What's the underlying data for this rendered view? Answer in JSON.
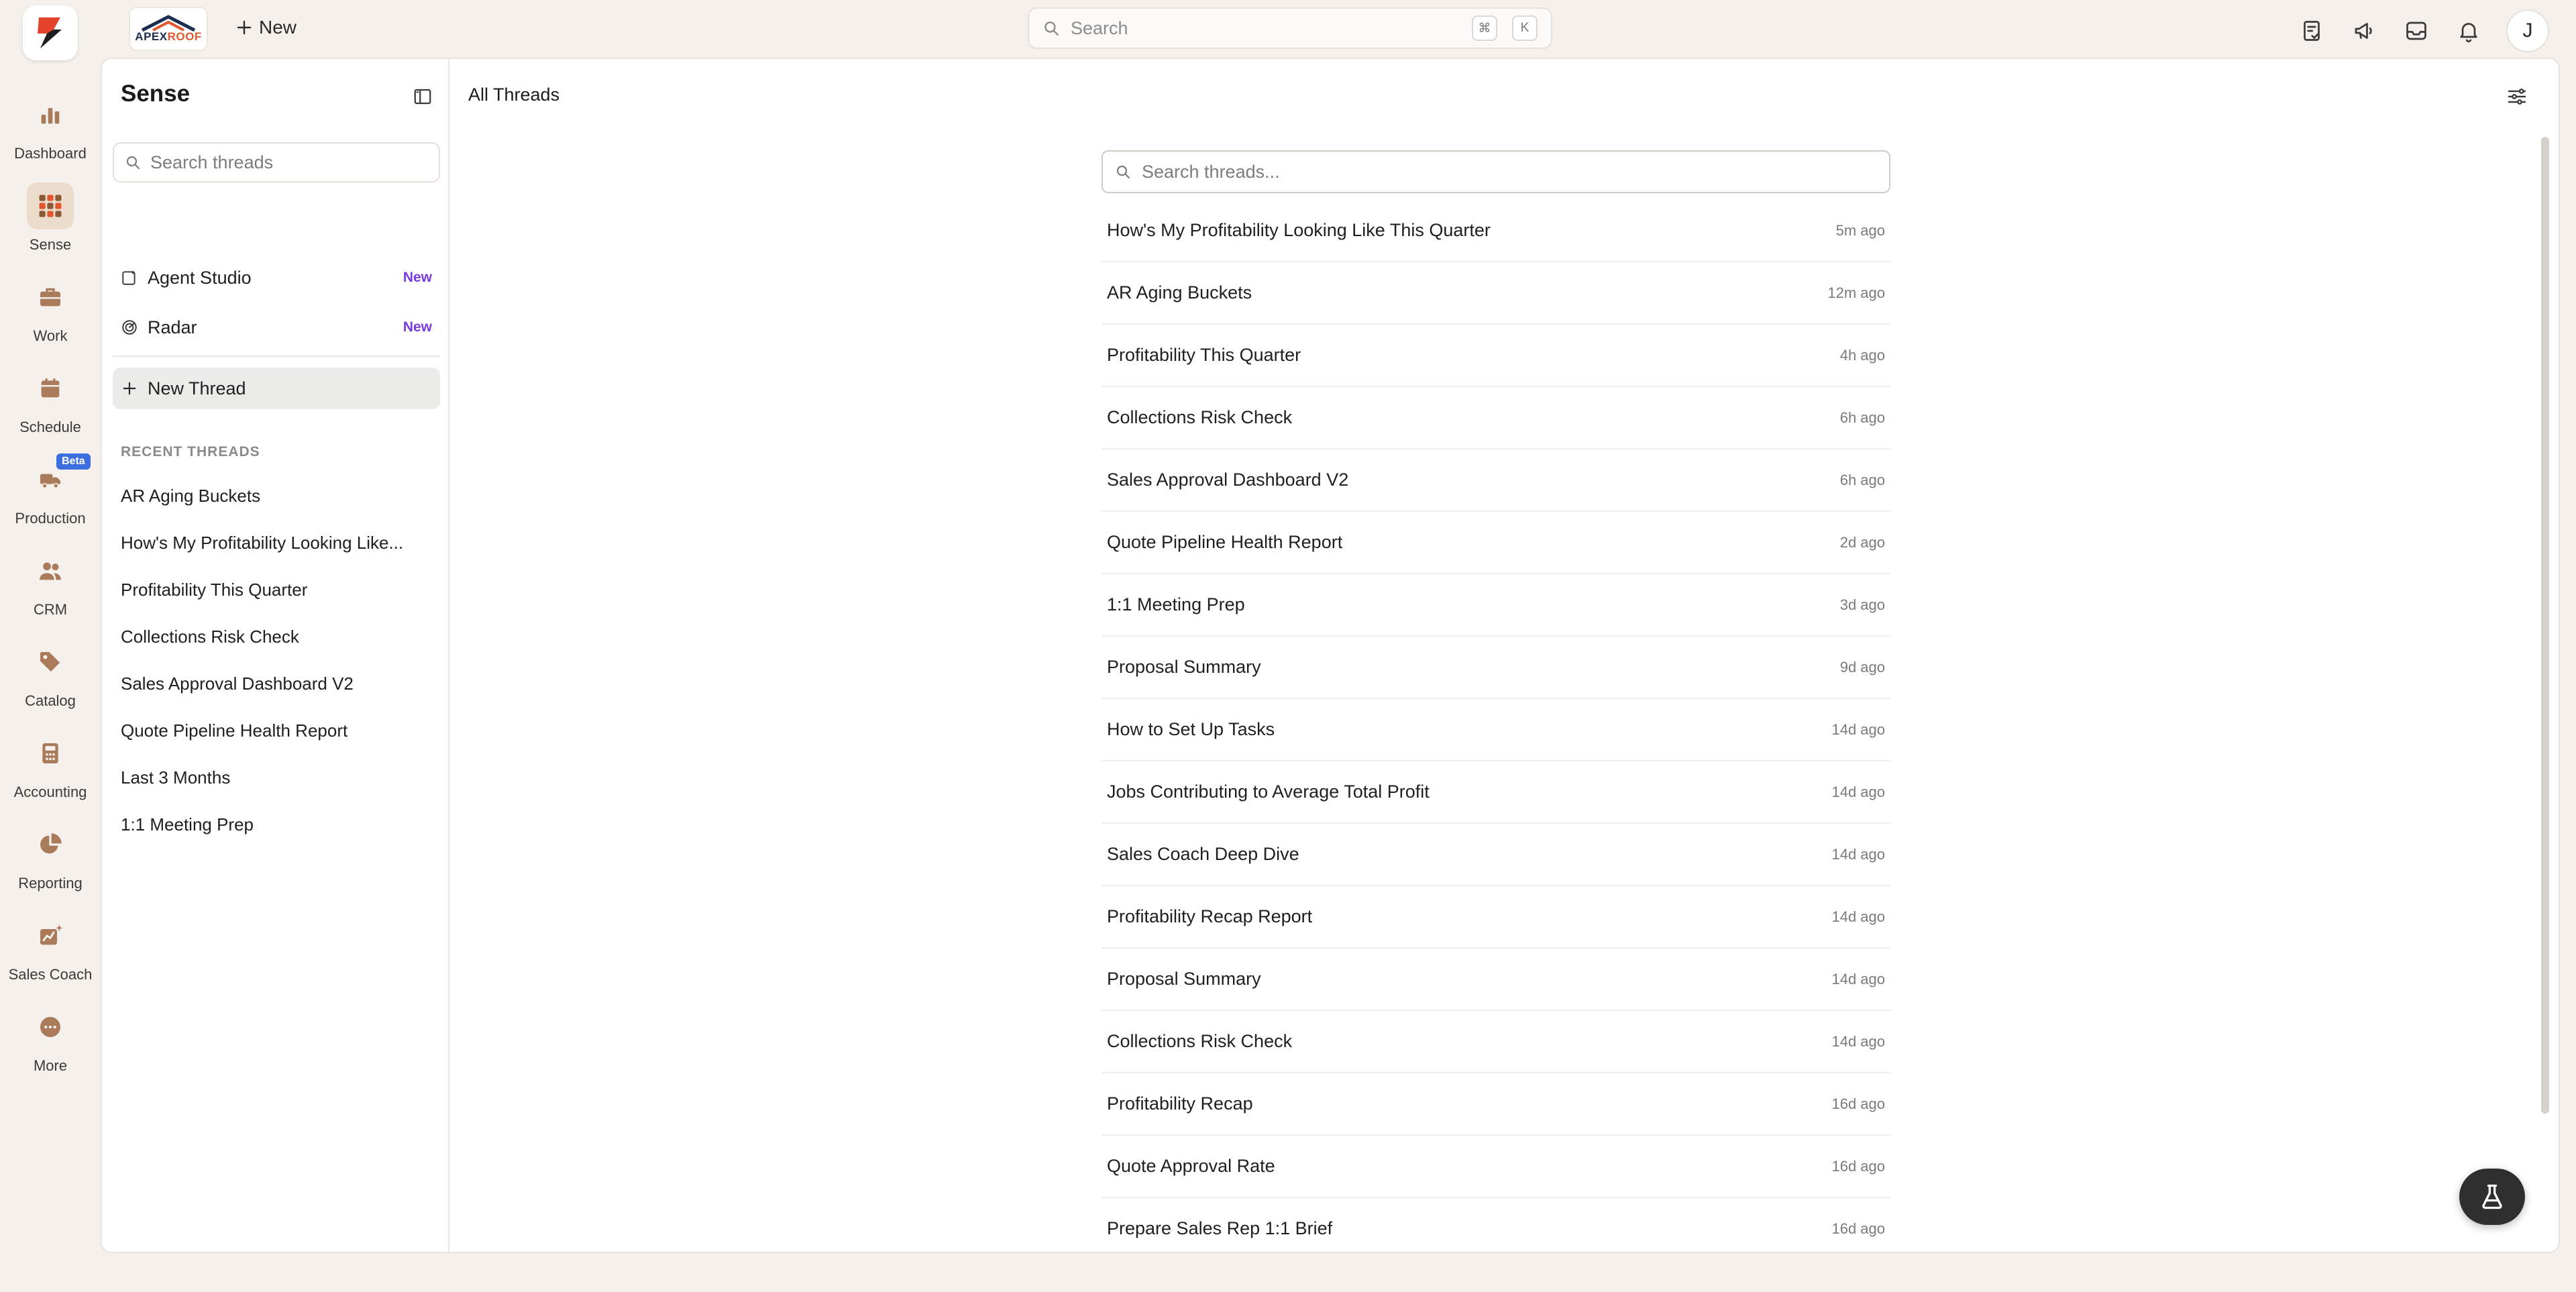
{
  "topbar": {
    "company_brand_left": "APEX",
    "company_brand_right": "ROOF",
    "new_label": "New",
    "search_placeholder": "Search",
    "kbd_cmd": "⌘",
    "kbd_k": "K",
    "avatar_initial": "J"
  },
  "rail": {
    "items": [
      {
        "label": "Dashboard",
        "icon": "bar-chart-icon"
      },
      {
        "label": "Sense",
        "icon": "grid-icon",
        "active": true
      },
      {
        "label": "Work",
        "icon": "briefcase-icon"
      },
      {
        "label": "Schedule",
        "icon": "calendar-icon"
      },
      {
        "label": "Production",
        "icon": "truck-icon",
        "badge": "Beta"
      },
      {
        "label": "CRM",
        "icon": "users-icon"
      },
      {
        "label": "Catalog",
        "icon": "tag-icon"
      },
      {
        "label": "Accounting",
        "icon": "calculator-icon"
      },
      {
        "label": "Reporting",
        "icon": "pie-chart-icon"
      },
      {
        "label": "Sales Coach",
        "icon": "sales-coach-icon"
      },
      {
        "label": "More",
        "icon": "more-icon"
      }
    ]
  },
  "sidebar": {
    "title": "Sense",
    "search_placeholder": "Search threads",
    "links": [
      {
        "label": "Agent Studio",
        "badge": "New"
      },
      {
        "label": "Radar",
        "badge": "New"
      }
    ],
    "new_thread_label": "New Thread",
    "recent_heading": "RECENT THREADS",
    "recent": [
      "AR Aging Buckets",
      "How's My Profitability Looking Like...",
      "Profitability This Quarter",
      "Collections Risk Check",
      "Sales Approval Dashboard V2",
      "Quote Pipeline Health Report",
      "Last 3 Months",
      "1:1 Meeting Prep"
    ]
  },
  "main": {
    "title": "All Threads",
    "search_placeholder": "Search threads...",
    "threads": [
      {
        "title": "How's My Profitability Looking Like This Quarter",
        "time": "5m ago"
      },
      {
        "title": "AR Aging Buckets",
        "time": "12m ago"
      },
      {
        "title": "Profitability This Quarter",
        "time": "4h ago"
      },
      {
        "title": "Collections Risk Check",
        "time": "6h ago"
      },
      {
        "title": "Sales Approval Dashboard V2",
        "time": "6h ago"
      },
      {
        "title": "Quote Pipeline Health Report",
        "time": "2d ago"
      },
      {
        "title": "1:1 Meeting Prep",
        "time": "3d ago"
      },
      {
        "title": "Proposal Summary",
        "time": "9d ago"
      },
      {
        "title": "How to Set Up Tasks",
        "time": "14d ago"
      },
      {
        "title": "Jobs Contributing to Average Total Profit",
        "time": "14d ago"
      },
      {
        "title": "Sales Coach Deep Dive",
        "time": "14d ago"
      },
      {
        "title": "Profitability Recap Report",
        "time": "14d ago"
      },
      {
        "title": "Proposal Summary",
        "time": "14d ago"
      },
      {
        "title": "Collections Risk Check",
        "time": "14d ago"
      },
      {
        "title": "Profitability Recap",
        "time": "16d ago"
      },
      {
        "title": "Quote Approval Rate",
        "time": "16d ago"
      },
      {
        "title": "Prepare Sales Rep 1:1 Brief",
        "time": "16d ago"
      }
    ]
  },
  "colors": {
    "accent_brown": "#a97b5a",
    "badge_purple": "#7a3ae0",
    "beta_blue": "#3b6fe0",
    "background": "#f5f0eb"
  }
}
